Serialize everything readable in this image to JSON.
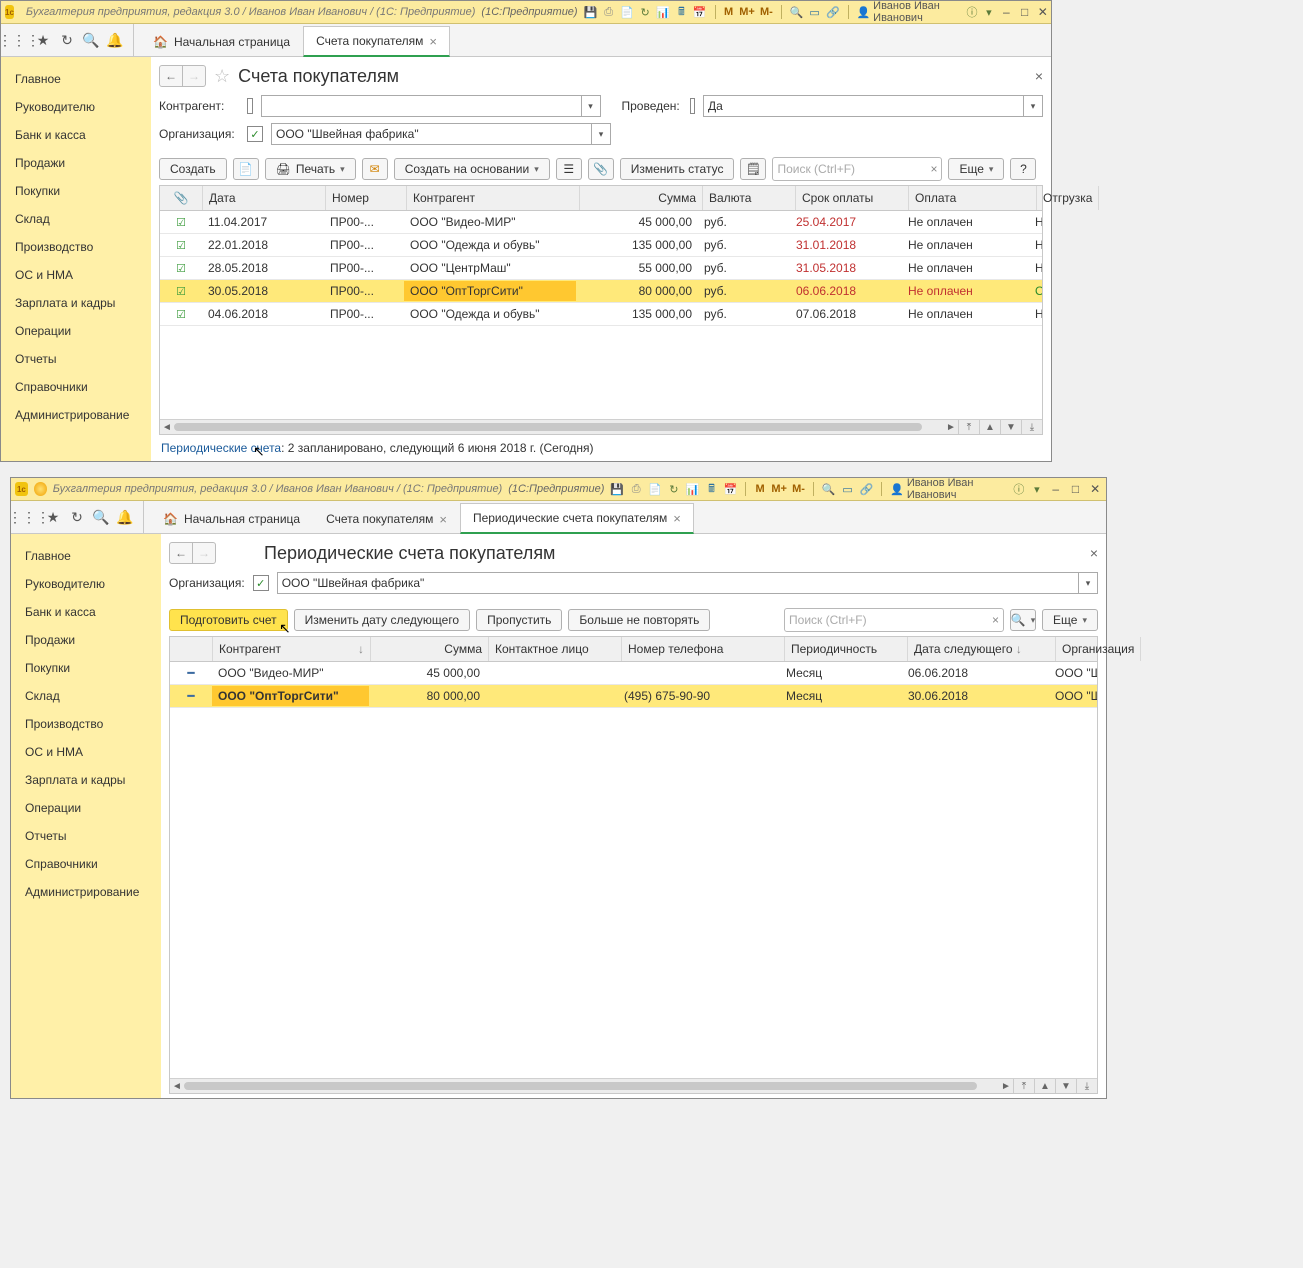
{
  "titlebar": {
    "app": "Бухгалтерия предприятия, редакция 3.0 / Иванов Иван Иванович / (1С: Предприятие)",
    "mid": "(1С:Предприятие)",
    "user": "Иванов Иван Иванович",
    "m": "M",
    "mplus": "M+",
    "mminus": "M-"
  },
  "tabs_top": {
    "home": "Начальная страница",
    "t1": "Счета покупателям"
  },
  "tabs_bottom": {
    "home": "Начальная страница",
    "t1": "Счета покупателям",
    "t2": "Периодические счета покупателям"
  },
  "sidebar": {
    "items": [
      "Главное",
      "Руководителю",
      "Банк и касса",
      "Продажи",
      "Покупки",
      "Склад",
      "Производство",
      "ОС и НМА",
      "Зарплата и кадры",
      "Операции",
      "Отчеты",
      "Справочники",
      "Администрирование"
    ]
  },
  "win1": {
    "title": "Счета покупателям",
    "filters": {
      "ctr_label": "Контрагент:",
      "prov_label": "Проведен:",
      "prov_value": "Да",
      "org_label": "Организация:",
      "org_value": "ООО \"Швейная фабрика\""
    },
    "buttons": {
      "create": "Создать",
      "print": "Печать",
      "createon": "Создать на основании",
      "status": "Изменить статус",
      "more": "Еще",
      "search_ph": "Поиск (Ctrl+F)"
    },
    "cols": {
      "date": "Дата",
      "num": "Номер",
      "ctr": "Контрагент",
      "sum": "Сумма",
      "cur": "Валюта",
      "due": "Срок оплаты",
      "pay": "Оплата",
      "ship": "Отгрузка"
    },
    "rows": [
      {
        "date": "11.04.2017",
        "num": "ПР00-...",
        "ctr": "ООО \"Видео-МИР\"",
        "sum": "45 000,00",
        "cur": "руб.",
        "due": "25.04.2017",
        "due_red": true,
        "pay": "Не оплачен",
        "ship": "Не отгружен"
      },
      {
        "date": "22.01.2018",
        "num": "ПР00-...",
        "ctr": "ООО \"Одежда и обувь\"",
        "sum": "135 000,00",
        "cur": "руб.",
        "due": "31.01.2018",
        "due_red": true,
        "pay": "Не оплачен",
        "ship": "Не отгружен"
      },
      {
        "date": "28.05.2018",
        "num": "ПР00-...",
        "ctr": "ООО \"ЦентрМаш\"",
        "sum": "55 000,00",
        "cur": "руб.",
        "due": "31.05.2018",
        "due_red": true,
        "pay": "Не оплачен",
        "ship": "Не отгружен"
      },
      {
        "date": "30.05.2018",
        "num": "ПР00-...",
        "ctr": "ООО \"ОптТоргСити\"",
        "sum": "80 000,00",
        "cur": "руб.",
        "due": "06.06.2018",
        "due_red": true,
        "pay": "Не оплачен",
        "pay_red": true,
        "ship": "Отгружен",
        "ship_green": true,
        "sel": true
      },
      {
        "date": "04.06.2018",
        "num": "ПР00-...",
        "ctr": "ООО \"Одежда и обувь\"",
        "sum": "135 000,00",
        "cur": "руб.",
        "due": "07.06.2018",
        "pay": "Не оплачен",
        "ship": "Не отгружен"
      }
    ],
    "footer_link": "Периодические счета",
    "footer_text": ": 2 запланировано, следующий 6 июня 2018 г. (Сегодня)"
  },
  "win2": {
    "title": "Периодические счета покупателям",
    "org_label": "Организация:",
    "org_value": "ООО \"Швейная фабрика\"",
    "buttons": {
      "prepare": "Подготовить счет",
      "nextdate": "Изменить дату следующего",
      "skip": "Пропустить",
      "norep": "Больше не повторять",
      "more": "Еще",
      "search_ph": "Поиск (Ctrl+F)"
    },
    "cols": {
      "ctr": "Контрагент",
      "sum": "Сумма",
      "contact": "Контактное лицо",
      "tel": "Номер телефона",
      "per": "Периодичность",
      "next": "Дата следующего",
      "org": "Организация"
    },
    "rows": [
      {
        "ctr": "ООО \"Видео-МИР\"",
        "sum": "45 000,00",
        "tel": "",
        "per": "Месяц",
        "next": "06.06.2018",
        "org": "ООО \"Швейная фабрика\""
      },
      {
        "ctr": "ООО \"ОптТоргСити\"",
        "sum": "80 000,00",
        "tel": "(495) 675-90-90",
        "per": "Месяц",
        "next": "30.06.2018",
        "org": "ООО \"Швейная фабрика\"",
        "sel": true
      }
    ]
  }
}
